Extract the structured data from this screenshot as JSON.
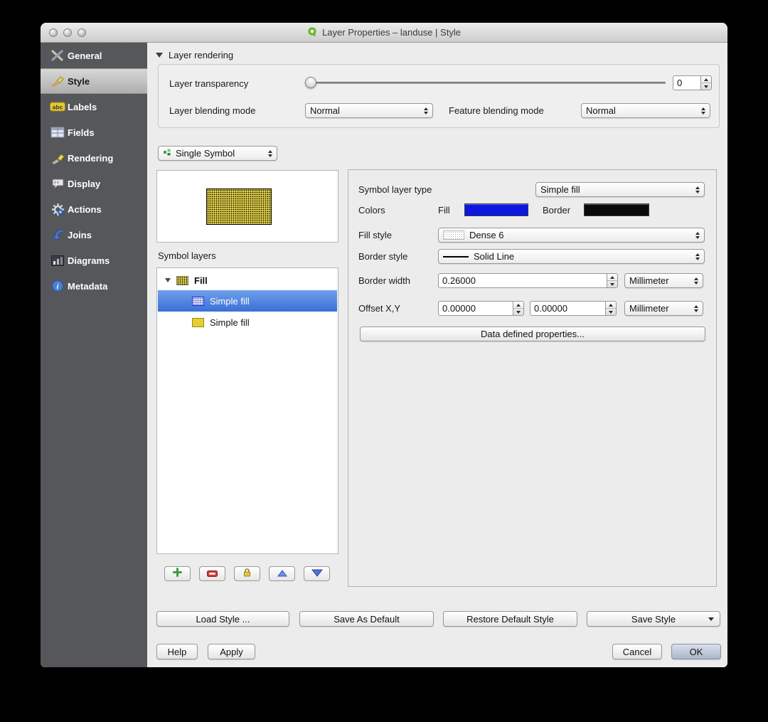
{
  "window": {
    "title": "Layer Properties – landuse | Style"
  },
  "sidebar": {
    "items": [
      {
        "label": "General"
      },
      {
        "label": "Style"
      },
      {
        "label": "Labels"
      },
      {
        "label": "Fields"
      },
      {
        "label": "Rendering"
      },
      {
        "label": "Display"
      },
      {
        "label": "Actions"
      },
      {
        "label": "Joins"
      },
      {
        "label": "Diagrams"
      },
      {
        "label": "Metadata"
      }
    ]
  },
  "layer_rendering": {
    "header": "Layer rendering",
    "transparency_label": "Layer transparency",
    "transparency_value": "0",
    "blend_label": "Layer blending mode",
    "blend_value": "Normal",
    "feature_blend_label": "Feature blending mode",
    "feature_blend_value": "Normal"
  },
  "symbol": {
    "renderer": "Single Symbol",
    "layers_header": "Symbol layers",
    "tree": [
      {
        "label": "Fill"
      },
      {
        "label": "Simple fill"
      },
      {
        "label": "Simple fill"
      }
    ]
  },
  "properties": {
    "type_label": "Symbol layer type",
    "type_value": "Simple fill",
    "colors_label": "Colors",
    "fill_label": "Fill",
    "border_label": "Border",
    "fill_style_label": "Fill style",
    "fill_style_value": "Dense 6",
    "border_style_label": "Border style",
    "border_style_value": "Solid Line",
    "border_width_label": "Border width",
    "border_width_value": "0.26000",
    "border_width_unit": "Millimeter",
    "offset_label": "Offset X,Y",
    "offset_x": "0.00000",
    "offset_y": "0.00000",
    "offset_unit": "Millimeter",
    "data_defined_button": "Data defined properties..."
  },
  "style_actions": {
    "load": "Load Style ...",
    "save_default": "Save As Default",
    "restore": "Restore Default Style",
    "save": "Save Style"
  },
  "dialog": {
    "help": "Help",
    "apply": "Apply",
    "cancel": "Cancel",
    "ok": "OK"
  },
  "colors": {
    "fill_swatch": "#0d17e0",
    "border_swatch": "#0a0a0a",
    "symbol_yellow": "#dccb45",
    "selection_blue": "#3a6fd6"
  }
}
